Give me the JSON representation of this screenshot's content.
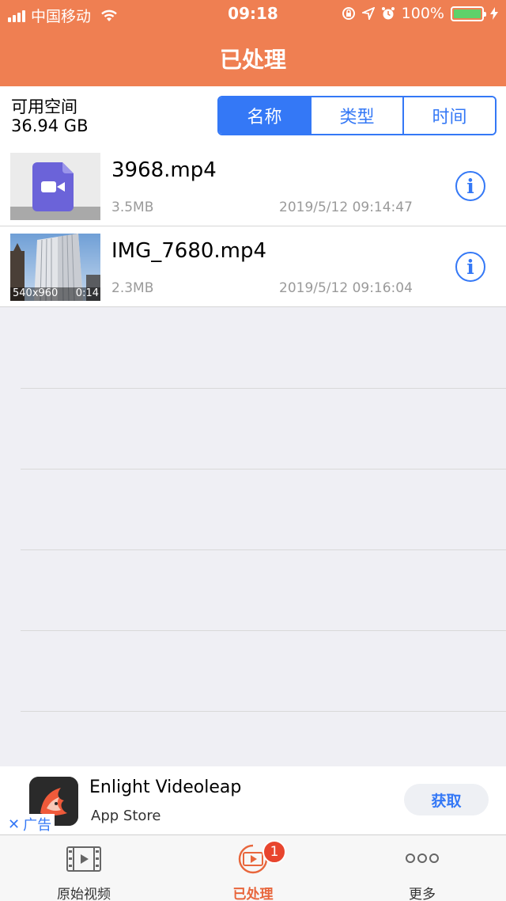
{
  "status_bar": {
    "carrier": "中国移动",
    "time": "09:18",
    "battery": "100%"
  },
  "nav": {
    "title": "已处理"
  },
  "storage": {
    "label": "可用空间",
    "value": "36.94 GB"
  },
  "sort_segments": [
    {
      "label": "名称",
      "active": true
    },
    {
      "label": "类型",
      "active": false
    },
    {
      "label": "时间",
      "active": false
    }
  ],
  "files": [
    {
      "name": "3968.mp4",
      "size": "3.5MB",
      "date": "2019/5/12 09:14:47",
      "thumb": "video-file-icon"
    },
    {
      "name": "IMG_7680.mp4",
      "size": "2.3MB",
      "date": "2019/5/12 09:16:04",
      "thumb": "building-photo",
      "resolution": "540x960",
      "duration": "0:14"
    }
  ],
  "info_glyph": "i",
  "ad": {
    "title": "Enlight Videoleap",
    "subtitle": "App Store",
    "button": "获取",
    "tag": "广告",
    "close": "✕"
  },
  "tabs": [
    {
      "label": "原始视频",
      "icon": "film-icon",
      "active": false
    },
    {
      "label": "已处理",
      "icon": "processed-video-icon",
      "active": true,
      "badge": "1"
    },
    {
      "label": "更多",
      "icon": "more-icon",
      "active": false
    }
  ],
  "colors": {
    "header": "#ef7f52",
    "accent": "#3478f6",
    "tab_active": "#e8663c",
    "badge": "#e8452e"
  }
}
